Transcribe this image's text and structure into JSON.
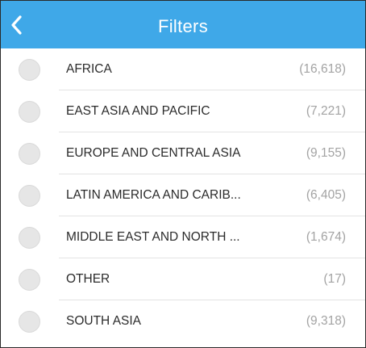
{
  "header": {
    "title": "Filters",
    "back_icon": "chevron-left-icon",
    "color": "#3fa8e8"
  },
  "filters": [
    {
      "label": "AFRICA",
      "count": "(16,618)"
    },
    {
      "label": "EAST ASIA AND PACIFIC",
      "count": "(7,221)"
    },
    {
      "label": "EUROPE AND CENTRAL ASIA",
      "count": "(9,155)"
    },
    {
      "label": "LATIN AMERICA AND CARIB...",
      "count": "(6,405)"
    },
    {
      "label": "MIDDLE EAST AND NORTH ...",
      "count": "(1,674)"
    },
    {
      "label": "OTHER",
      "count": "(17)"
    },
    {
      "label": "SOUTH ASIA",
      "count": "(9,318)"
    }
  ]
}
